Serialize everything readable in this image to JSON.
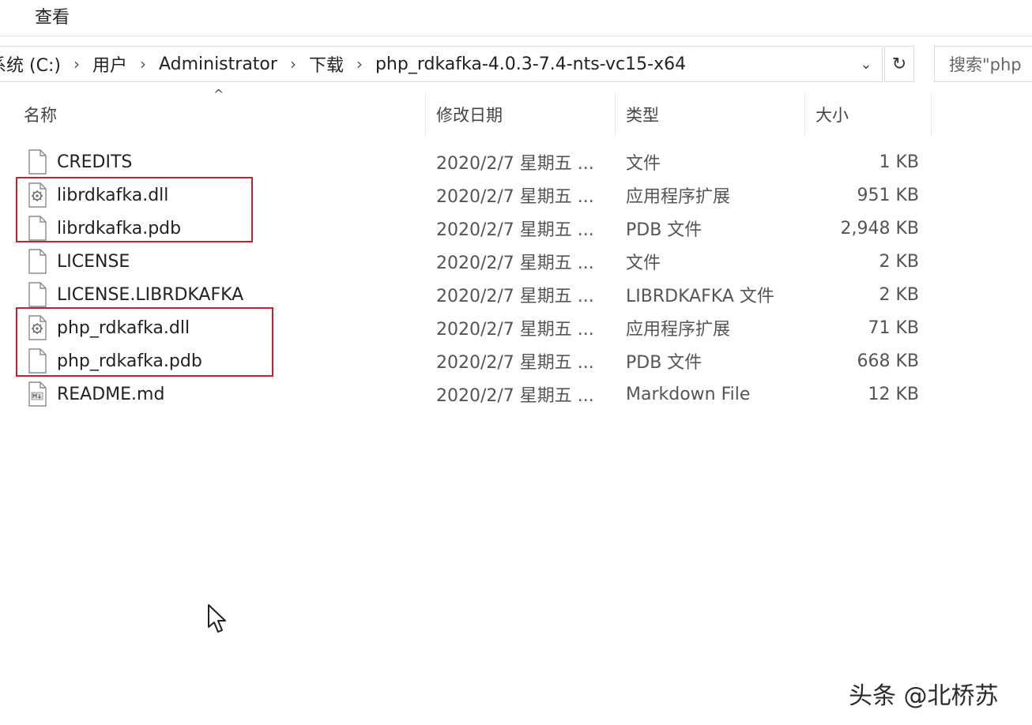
{
  "ribbon": {
    "tab_label": "查看"
  },
  "address_bar": {
    "crumbs": [
      "系统 (C:)",
      "用户",
      "Administrator",
      "下载",
      "php_rdkafka-4.0.3-7.4-nts-vc15-x64"
    ],
    "separator": "›",
    "dropdown_glyph": "⌄",
    "refresh_glyph": "↻"
  },
  "search": {
    "placeholder": "搜索\"php"
  },
  "columns": {
    "name": "名称",
    "date": "修改日期",
    "type": "类型",
    "size": "大小",
    "sort_glyph": "^"
  },
  "files": [
    {
      "name": "CREDITS",
      "date": "2020/2/7 星期五 ...",
      "type": "文件",
      "size": "1 KB",
      "icon": "file-icon"
    },
    {
      "name": "librdkafka.dll",
      "date": "2020/2/7 星期五 ...",
      "type": "应用程序扩展",
      "size": "951 KB",
      "icon": "dll-gear-icon"
    },
    {
      "name": "librdkafka.pdb",
      "date": "2020/2/7 星期五 ...",
      "type": "PDB 文件",
      "size": "2,948 KB",
      "icon": "file-icon"
    },
    {
      "name": "LICENSE",
      "date": "2020/2/7 星期五 ...",
      "type": "文件",
      "size": "2 KB",
      "icon": "file-icon"
    },
    {
      "name": "LICENSE.LIBRDKAFKA",
      "date": "2020/2/7 星期五 ...",
      "type": "LIBRDKAFKA 文件",
      "size": "2 KB",
      "icon": "file-icon"
    },
    {
      "name": "php_rdkafka.dll",
      "date": "2020/2/7 星期五 ...",
      "type": "应用程序扩展",
      "size": "71 KB",
      "icon": "dll-gear-icon"
    },
    {
      "name": "php_rdkafka.pdb",
      "date": "2020/2/7 星期五 ...",
      "type": "PDB 文件",
      "size": "668 KB",
      "icon": "file-icon"
    },
    {
      "name": "README.md",
      "date": "2020/2/7 星期五 ...",
      "type": "Markdown File",
      "size": "12 KB",
      "icon": "markdown-file-icon"
    }
  ],
  "highlight_color": "#c8202a",
  "watermark": "头条 @北桥苏"
}
